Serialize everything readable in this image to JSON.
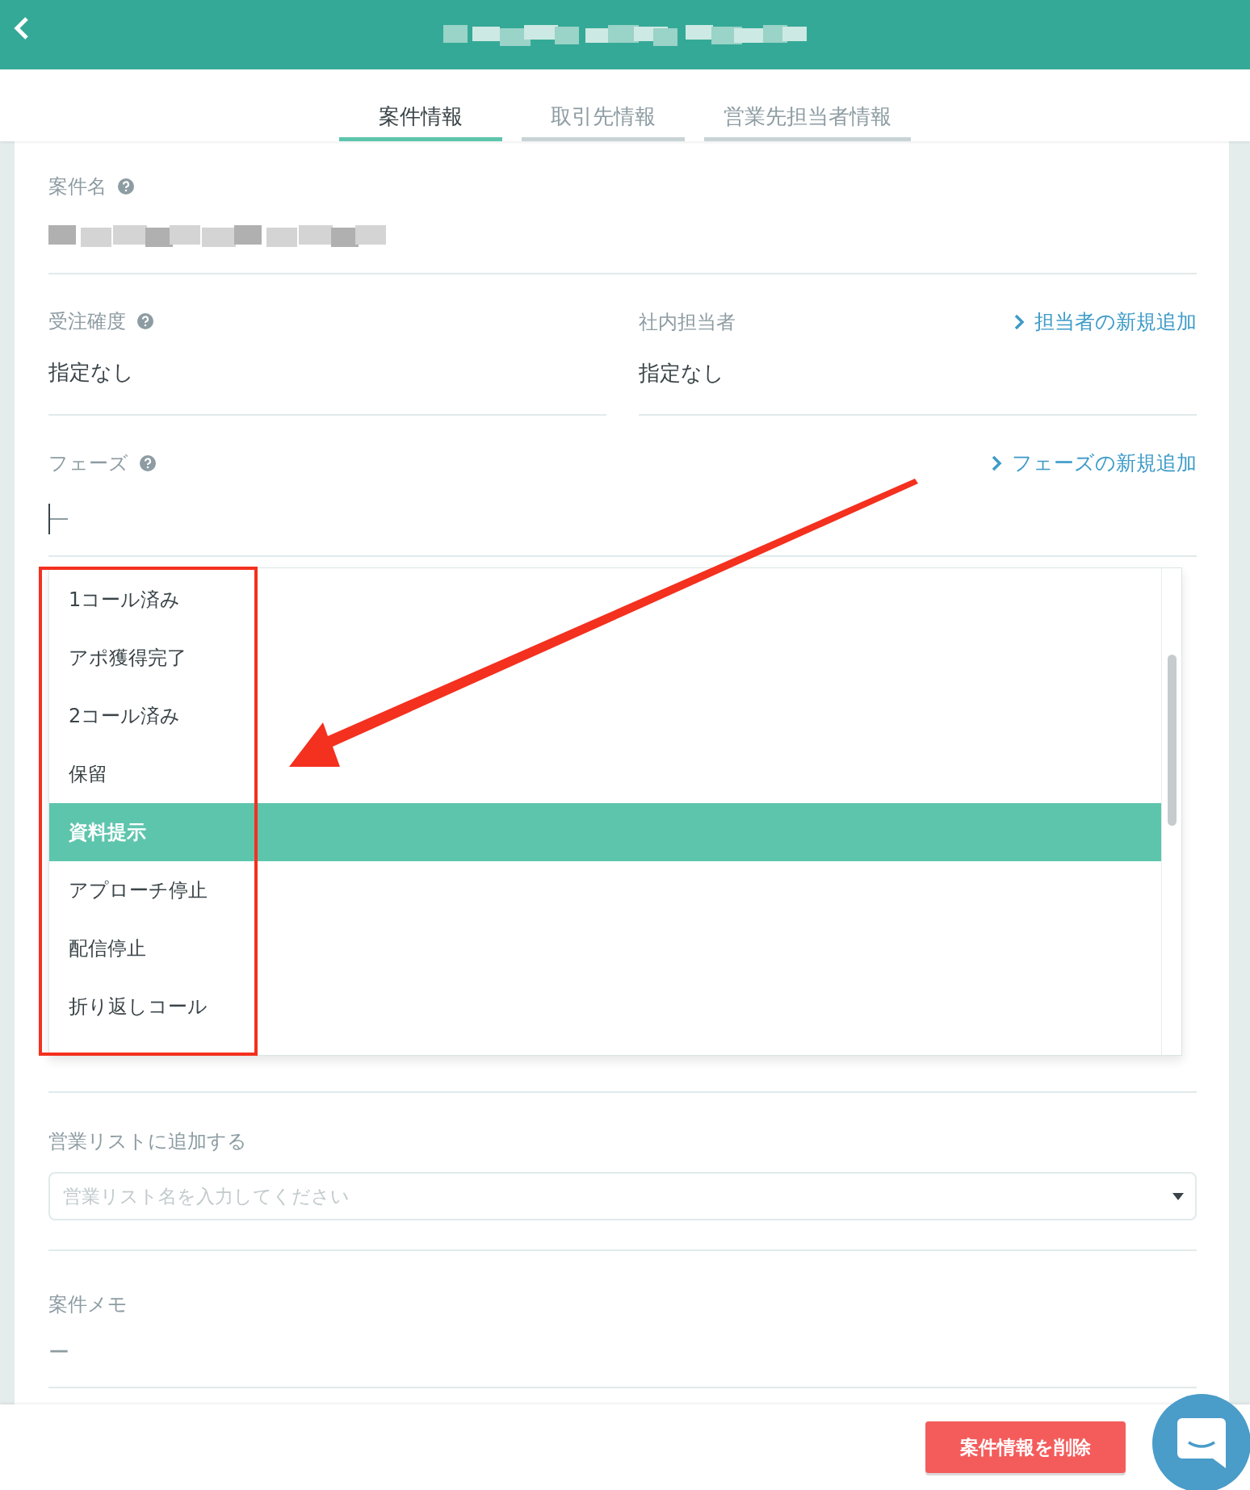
{
  "tabs": [
    {
      "label": "案件情報",
      "selected": true
    },
    {
      "label": "取引先情報",
      "selected": false
    },
    {
      "label": "営業先担当者情報",
      "selected": false
    }
  ],
  "case_name": {
    "label": "案件名"
  },
  "probability": {
    "label": "受注確度",
    "value": "指定なし"
  },
  "owner": {
    "label": "社内担当者",
    "value": "指定なし",
    "link": "担当者の新規追加"
  },
  "phase": {
    "label": "フェーズ",
    "link": "フェーズの新規追加",
    "options": [
      {
        "label": "1コール済み",
        "selected": false
      },
      {
        "label": "アポ獲得完了",
        "selected": false
      },
      {
        "label": "2コール済み",
        "selected": false
      },
      {
        "label": "保留",
        "selected": false
      },
      {
        "label": "資料提示",
        "selected": true
      },
      {
        "label": "アプローチ停止",
        "selected": false
      },
      {
        "label": "配信停止",
        "selected": false
      },
      {
        "label": "折り返しコール",
        "selected": false
      }
    ]
  },
  "sales_list": {
    "label": "営業リストに追加する",
    "placeholder": "営業リスト名を入力してください"
  },
  "memo": {
    "label": "案件メモ",
    "value": "ー"
  },
  "delete_button": "案件情報を削除"
}
